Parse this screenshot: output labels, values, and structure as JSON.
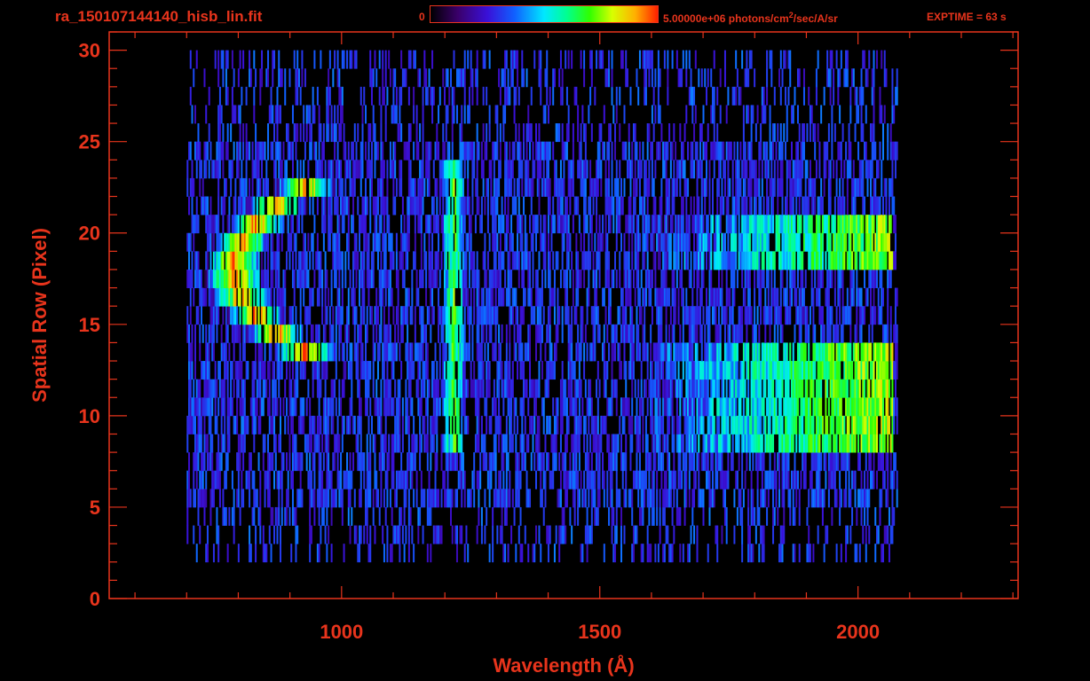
{
  "header": {
    "file_title": "ra_150107144140_hisb_lin.fit",
    "colorbar_min": "0",
    "colorbar_max_value": "5.00000e+06 photons/cm",
    "colorbar_max_exp": "2",
    "colorbar_max_unit": "/sec/A/sr",
    "exptime": "EXPTIME = 63 s"
  },
  "colors": {
    "axis": "#e8341c",
    "background": "#000000"
  },
  "chart_data": {
    "type": "heatmap",
    "title": "ra_150107144140_hisb_lin.fit",
    "xlabel": "Wavelength (Å)",
    "ylabel": "Spatial Row (Pixel)",
    "xlim": [
      550,
      2310
    ],
    "ylim": [
      0,
      31
    ],
    "x_ticks": [
      1000,
      1500,
      2000
    ],
    "y_ticks": [
      0,
      5,
      10,
      15,
      20,
      25,
      30
    ],
    "colorscale": [
      "#000000",
      "#3a006a",
      "#3a10d8",
      "#1060ff",
      "#00e8ff",
      "#00ff90",
      "#30ff00",
      "#d8ff00",
      "#ffb000",
      "#ff2000"
    ],
    "zlim": [
      0,
      5000000
    ],
    "zunit": "photons/cm^2/sec/A/sr",
    "features": [
      {
        "kind": "arc",
        "x_range": [
          770,
          980
        ],
        "y_range": [
          13,
          23
        ],
        "intensity": 0.8
      },
      {
        "kind": "line",
        "x": 1216,
        "y_range": [
          8,
          24
        ],
        "intensity": 0.65
      },
      {
        "kind": "band",
        "x_range": [
          1600,
          2065
        ],
        "y_range": [
          8,
          14
        ],
        "intensity": 0.75
      },
      {
        "kind": "band",
        "x_range": [
          1600,
          2065
        ],
        "y_range": [
          18,
          21
        ],
        "intensity": 0.7
      }
    ]
  }
}
